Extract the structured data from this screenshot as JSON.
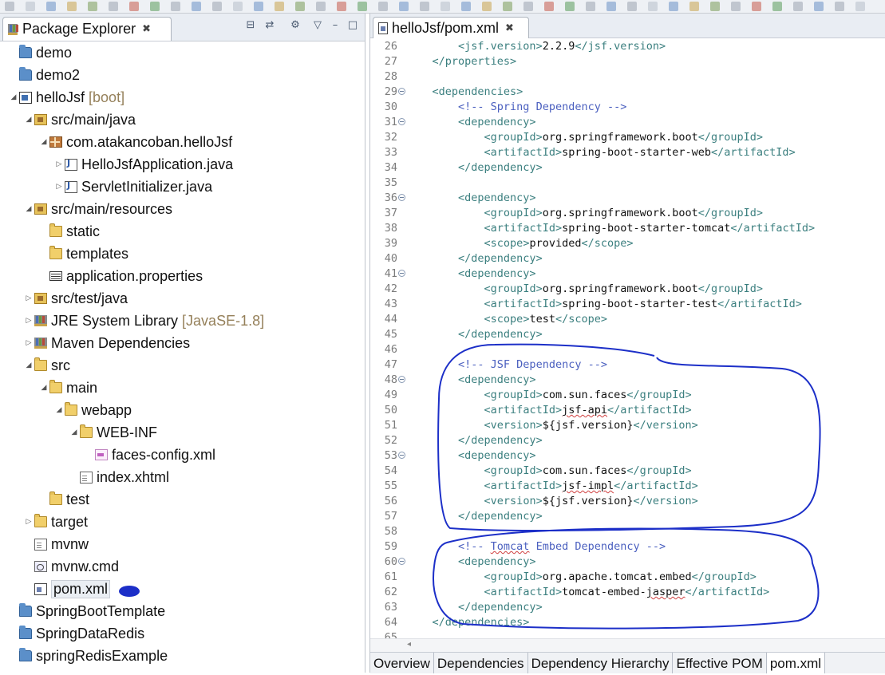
{
  "explorer": {
    "title": "Package Explorer",
    "close_glyph": "✖",
    "tree": [
      {
        "label": "demo",
        "indent": 0,
        "arrow": "",
        "icon": "project"
      },
      {
        "label": "demo2",
        "indent": 0,
        "arrow": "",
        "icon": "project"
      },
      {
        "label": "helloJsf",
        "indent": 0,
        "arrow": "◢",
        "icon": "mvnproj",
        "decor": "[boot]"
      },
      {
        "label": "src/main/java",
        "indent": 1,
        "arrow": "◢",
        "icon": "srcfolder"
      },
      {
        "label": "com.atakancoban.helloJsf",
        "indent": 2,
        "arrow": "◢",
        "icon": "package"
      },
      {
        "label": "HelloJsfApplication.java",
        "indent": 3,
        "arrow": "▷",
        "icon": "java"
      },
      {
        "label": "ServletInitializer.java",
        "indent": 3,
        "arrow": "▷",
        "icon": "java"
      },
      {
        "label": "src/main/resources",
        "indent": 1,
        "arrow": "◢",
        "icon": "srcfolder"
      },
      {
        "label": "static",
        "indent": 2,
        "arrow": "",
        "icon": "folder"
      },
      {
        "label": "templates",
        "indent": 2,
        "arrow": "",
        "icon": "folder"
      },
      {
        "label": "application.properties",
        "indent": 2,
        "arrow": "",
        "icon": "props"
      },
      {
        "label": "src/test/java",
        "indent": 1,
        "arrow": "▷",
        "icon": "srcfolder"
      },
      {
        "label": "JRE System Library",
        "indent": 1,
        "arrow": "▷",
        "icon": "lib",
        "decor": "[JavaSE-1.8]"
      },
      {
        "label": "Maven Dependencies",
        "indent": 1,
        "arrow": "▷",
        "icon": "lib"
      },
      {
        "label": "src",
        "indent": 1,
        "arrow": "◢",
        "icon": "folder"
      },
      {
        "label": "main",
        "indent": 2,
        "arrow": "◢",
        "icon": "folder"
      },
      {
        "label": "webapp",
        "indent": 3,
        "arrow": "◢",
        "icon": "folder"
      },
      {
        "label": "WEB-INF",
        "indent": 4,
        "arrow": "◢",
        "icon": "folder"
      },
      {
        "label": "faces-config.xml",
        "indent": 5,
        "arrow": "",
        "icon": "xml"
      },
      {
        "label": "index.xhtml",
        "indent": 4,
        "arrow": "",
        "icon": "file"
      },
      {
        "label": "test",
        "indent": 2,
        "arrow": "",
        "icon": "folder"
      },
      {
        "label": "target",
        "indent": 1,
        "arrow": "▷",
        "icon": "folder"
      },
      {
        "label": "mvnw",
        "indent": 1,
        "arrow": "",
        "icon": "file"
      },
      {
        "label": "mvnw.cmd",
        "indent": 1,
        "arrow": "",
        "icon": "cmd"
      },
      {
        "label": "pom.xml",
        "indent": 1,
        "arrow": "",
        "icon": "pom",
        "selected": true
      },
      {
        "label": "SpringBootTemplate",
        "indent": 0,
        "arrow": "",
        "icon": "project"
      },
      {
        "label": "SpringDataRedis",
        "indent": 0,
        "arrow": "",
        "icon": "project"
      },
      {
        "label": "springRedisExample",
        "indent": 0,
        "arrow": "",
        "icon": "project"
      }
    ]
  },
  "editor": {
    "tab_title": "helloJsf/pom.xml",
    "close_glyph": "✖",
    "lines": [
      {
        "n": "26",
        "indent": 2,
        "parts": [
          [
            "tag",
            "<jsf.version>"
          ],
          [
            "content",
            "2.2.9"
          ],
          [
            "tag",
            "</jsf.version>"
          ]
        ]
      },
      {
        "n": "27",
        "indent": 1,
        "parts": [
          [
            "tag",
            "</properties>"
          ]
        ]
      },
      {
        "n": "28",
        "indent": 0,
        "parts": []
      },
      {
        "n": "29",
        "indent": 1,
        "fold": true,
        "parts": [
          [
            "tag",
            "<dependencies>"
          ]
        ]
      },
      {
        "n": "30",
        "indent": 2,
        "parts": [
          [
            "comment",
            "<!-- Spring Dependency -->"
          ]
        ]
      },
      {
        "n": "31",
        "indent": 2,
        "fold": true,
        "parts": [
          [
            "tag",
            "<dependency>"
          ]
        ]
      },
      {
        "n": "32",
        "indent": 3,
        "parts": [
          [
            "tag",
            "<groupId>"
          ],
          [
            "content",
            "org.springframework.boot"
          ],
          [
            "tag",
            "</groupId>"
          ]
        ]
      },
      {
        "n": "33",
        "indent": 3,
        "parts": [
          [
            "tag",
            "<artifactId>"
          ],
          [
            "content",
            "spring-boot-starter-web"
          ],
          [
            "tag",
            "</artifactId>"
          ]
        ]
      },
      {
        "n": "34",
        "indent": 2,
        "parts": [
          [
            "tag",
            "</dependency>"
          ]
        ]
      },
      {
        "n": "35",
        "indent": 0,
        "parts": []
      },
      {
        "n": "36",
        "indent": 2,
        "fold": true,
        "parts": [
          [
            "tag",
            "<dependency>"
          ]
        ]
      },
      {
        "n": "37",
        "indent": 3,
        "parts": [
          [
            "tag",
            "<groupId>"
          ],
          [
            "content",
            "org.springframework.boot"
          ],
          [
            "tag",
            "</groupId>"
          ]
        ]
      },
      {
        "n": "38",
        "indent": 3,
        "parts": [
          [
            "tag",
            "<artifactId>"
          ],
          [
            "content",
            "spring-boot-starter-tomcat"
          ],
          [
            "tag",
            "</artifactId>"
          ]
        ]
      },
      {
        "n": "39",
        "indent": 3,
        "parts": [
          [
            "tag",
            "<scope>"
          ],
          [
            "content",
            "provided"
          ],
          [
            "tag",
            "</scope>"
          ]
        ]
      },
      {
        "n": "40",
        "indent": 2,
        "parts": [
          [
            "tag",
            "</dependency>"
          ]
        ]
      },
      {
        "n": "41",
        "indent": 2,
        "fold": true,
        "parts": [
          [
            "tag",
            "<dependency>"
          ]
        ]
      },
      {
        "n": "42",
        "indent": 3,
        "parts": [
          [
            "tag",
            "<groupId>"
          ],
          [
            "content",
            "org.springframework.boot"
          ],
          [
            "tag",
            "</groupId>"
          ]
        ]
      },
      {
        "n": "43",
        "indent": 3,
        "parts": [
          [
            "tag",
            "<artifactId>"
          ],
          [
            "content",
            "spring-boot-starter-test"
          ],
          [
            "tag",
            "</artifactId>"
          ]
        ]
      },
      {
        "n": "44",
        "indent": 3,
        "parts": [
          [
            "tag",
            "<scope>"
          ],
          [
            "content",
            "test"
          ],
          [
            "tag",
            "</scope>"
          ]
        ]
      },
      {
        "n": "45",
        "indent": 2,
        "parts": [
          [
            "tag",
            "</dependency>"
          ]
        ]
      },
      {
        "n": "46",
        "indent": 0,
        "parts": []
      },
      {
        "n": "47",
        "indent": 2,
        "parts": [
          [
            "comment",
            "<!-- JSF Dependency -->"
          ]
        ]
      },
      {
        "n": "48",
        "indent": 2,
        "fold": true,
        "parts": [
          [
            "tag",
            "<dependency>"
          ]
        ]
      },
      {
        "n": "49",
        "indent": 3,
        "parts": [
          [
            "tag",
            "<groupId>"
          ],
          [
            "content",
            "com.sun.faces"
          ],
          [
            "tag",
            "</groupId>"
          ]
        ]
      },
      {
        "n": "50",
        "indent": 3,
        "parts": [
          [
            "tag",
            "<artifactId>"
          ],
          [
            "content",
            "jsf-api",
            "sq"
          ],
          [
            "tag",
            "</artifactId>"
          ]
        ]
      },
      {
        "n": "51",
        "indent": 3,
        "parts": [
          [
            "tag",
            "<version>"
          ],
          [
            "content",
            "${jsf.version}"
          ],
          [
            "tag",
            "</version>"
          ]
        ]
      },
      {
        "n": "52",
        "indent": 2,
        "parts": [
          [
            "tag",
            "</dependency>"
          ]
        ]
      },
      {
        "n": "53",
        "indent": 2,
        "fold": true,
        "parts": [
          [
            "tag",
            "<dependency>"
          ]
        ]
      },
      {
        "n": "54",
        "indent": 3,
        "parts": [
          [
            "tag",
            "<groupId>"
          ],
          [
            "content",
            "com.sun.faces"
          ],
          [
            "tag",
            "</groupId>"
          ]
        ]
      },
      {
        "n": "55",
        "indent": 3,
        "parts": [
          [
            "tag",
            "<artifactId>"
          ],
          [
            "content",
            "jsf-impl",
            "sq"
          ],
          [
            "tag",
            "</artifactId>"
          ]
        ]
      },
      {
        "n": "56",
        "indent": 3,
        "parts": [
          [
            "tag",
            "<version>"
          ],
          [
            "content",
            "${jsf.version}"
          ],
          [
            "tag",
            "</version>"
          ]
        ]
      },
      {
        "n": "57",
        "indent": 2,
        "parts": [
          [
            "tag",
            "</dependency>"
          ]
        ]
      },
      {
        "n": "58",
        "indent": 0,
        "parts": []
      },
      {
        "n": "59",
        "indent": 2,
        "parts": [
          [
            "comment",
            "<!-- "
          ],
          [
            "comment",
            "Tomcat",
            "sq"
          ],
          [
            "comment",
            " Embed Dependency -->"
          ]
        ]
      },
      {
        "n": "60",
        "indent": 2,
        "fold": true,
        "parts": [
          [
            "tag",
            "<dependency>"
          ]
        ]
      },
      {
        "n": "61",
        "indent": 3,
        "parts": [
          [
            "tag",
            "<groupId>"
          ],
          [
            "content",
            "org.apache.tomcat.embed"
          ],
          [
            "tag",
            "</groupId>"
          ]
        ]
      },
      {
        "n": "62",
        "indent": 3,
        "parts": [
          [
            "tag",
            "<artifactId>"
          ],
          [
            "content",
            "tomcat-embed-"
          ],
          [
            "content",
            "jasper",
            "sq"
          ],
          [
            "tag",
            "</artifactId>"
          ]
        ]
      },
      {
        "n": "63",
        "indent": 2,
        "parts": [
          [
            "tag",
            "</dependency>"
          ]
        ]
      },
      {
        "n": "64",
        "indent": 1,
        "parts": [
          [
            "tag",
            "</dependencies>"
          ]
        ]
      },
      {
        "n": "65",
        "indent": 0,
        "parts": []
      }
    ],
    "bottom_tabs": [
      "Overview",
      "Dependencies",
      "Dependency Hierarchy",
      "Effective POM",
      "pom.xml"
    ],
    "active_bottom_tab": "pom.xml"
  },
  "colors": {
    "tag": "#3b7f7f",
    "comment": "#4a5fbf",
    "annotation_ink": "#1c2fc8"
  }
}
